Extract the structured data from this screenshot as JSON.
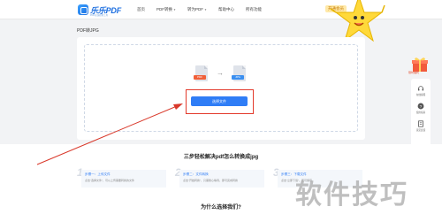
{
  "header": {
    "logo_text": "乐乐PDF",
    "logo_sub": "PDF在线转换工具",
    "nav": [
      {
        "label": "首页",
        "has_caret": false
      },
      {
        "label": "PDF转换",
        "has_caret": true
      },
      {
        "label": "转为PDF",
        "has_caret": true
      },
      {
        "label": "帮助中心",
        "has_caret": false
      },
      {
        "label": "所有功能",
        "has_caret": false
      }
    ],
    "promo": "开通会员"
  },
  "page": {
    "title": "PDF转JPG"
  },
  "upload": {
    "from_tag": "PDF",
    "to_tag": "JPG",
    "arrow": "→",
    "button_label": "选择文件"
  },
  "side": {
    "gift_label": "限时福利",
    "items": [
      {
        "label": "在线客服",
        "icon": "headset-icon"
      },
      {
        "label": "使用指南",
        "icon": "question-icon"
      },
      {
        "label": "意见反馈",
        "icon": "feedback-icon"
      }
    ]
  },
  "steps": {
    "title": "三步轻松解决pdf怎么转换成jpg",
    "items": [
      {
        "num": "1",
        "head": "步骤一：上传文件",
        "desc": "点击“选择文件”，可以上传需要转换的文件"
      },
      {
        "num": "2",
        "head": "步骤二：文件转换",
        "desc": "点击“开始转换”，只需耐心等待，即可完成转换"
      },
      {
        "num": "3",
        "head": "步骤三：下载文件",
        "desc": "点击“立即下载”，即可保存"
      }
    ]
  },
  "why_title": "为什么选择我们?",
  "watermark": "软件技巧",
  "colors": {
    "accent": "#2f7df6",
    "highlight": "#e33a2c",
    "pdf": "#f0603a",
    "jpg": "#3b8ff0"
  }
}
